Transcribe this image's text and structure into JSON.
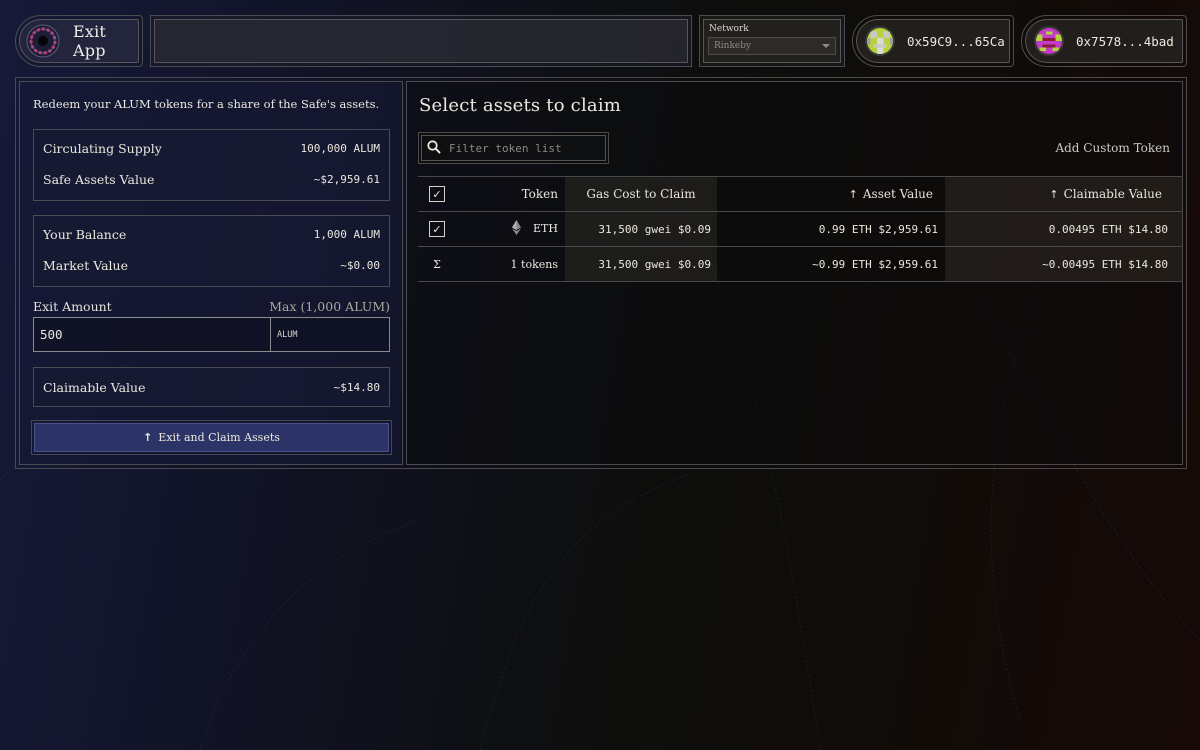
{
  "header": {
    "app_title": "Exit App",
    "network": {
      "label": "Network",
      "selected": "Rinkeby"
    },
    "wallets": [
      {
        "address": "0x59C9...65Ca",
        "avatar_colors": [
          "#b5d33c",
          "#c8c8c8"
        ]
      },
      {
        "address": "0x7578...4bad",
        "avatar_colors": [
          "#b5d33c",
          "#c23bc9",
          "#8a1c3a"
        ]
      }
    ]
  },
  "left_panel": {
    "intro": "Redeem your ALUM tokens for a share of the Safe's assets.",
    "supply_box": [
      {
        "label": "Circulating Supply",
        "value": "100,000 ALUM"
      },
      {
        "label": "Safe Assets Value",
        "value": "~$2,959.61"
      }
    ],
    "balance_box": [
      {
        "label": "Your Balance",
        "value": "1,000 ALUM"
      },
      {
        "label": "Market Value",
        "value": "~$0.00"
      }
    ],
    "exit_amount": {
      "label": "Exit Amount",
      "max_label": "Max (1,000 ALUM)",
      "value": "500",
      "unit": "ALUM"
    },
    "claimable": {
      "label": "Claimable Value",
      "value": "~$14.80"
    },
    "claim_button": {
      "label": "Exit and Claim Assets",
      "icon": "arrow-up-icon"
    }
  },
  "right_panel": {
    "title": "Select assets to claim",
    "filter_placeholder": "Filter token list",
    "add_custom_token": "Add Custom Token",
    "table": {
      "headers": {
        "token": "Token",
        "gas": "Gas Cost to Claim",
        "asset_value": "Asset Value",
        "claimable_value": "Claimable Value"
      },
      "header_checked": true,
      "rows": [
        {
          "checked": true,
          "token": "ETH",
          "token_icon": "ethereum-icon",
          "gas": "31,500 gwei $0.09",
          "asset_value": "0.99 ETH $2,959.61",
          "claimable_value": "0.00495 ETH $14.80"
        }
      ],
      "summary": {
        "symbol": "Σ",
        "token": "1 tokens",
        "gas": "31,500 gwei $0.09",
        "asset_value": "~0.99 ETH $2,959.61",
        "claimable_value": "~0.00495 ETH $14.80"
      }
    }
  }
}
